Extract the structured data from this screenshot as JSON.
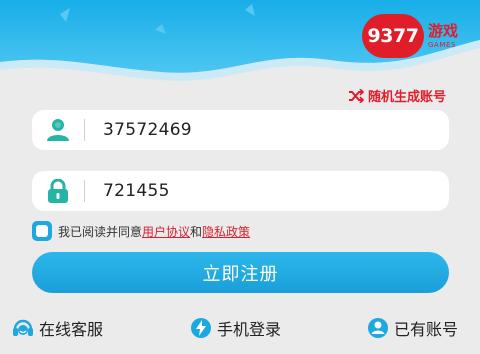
{
  "logo": {
    "number": "9377",
    "cn": "游戏",
    "en": "GAMES"
  },
  "random_account_label": "随机生成账号",
  "account_field": {
    "value": "37572469"
  },
  "password_field": {
    "value": "721455"
  },
  "agreement": {
    "prefix": "我已阅读并同意",
    "user_agreement": "用户协议",
    "and": "和",
    "privacy_policy": "隐私政策"
  },
  "register_button": "立即注册",
  "bottom": {
    "service": "在线客服",
    "phone_login": "手机登录",
    "has_account": "已有账号"
  },
  "colors": {
    "accent_blue": "#1da8e0",
    "brand_red": "#e11d2a",
    "background": "#ebebeb"
  }
}
